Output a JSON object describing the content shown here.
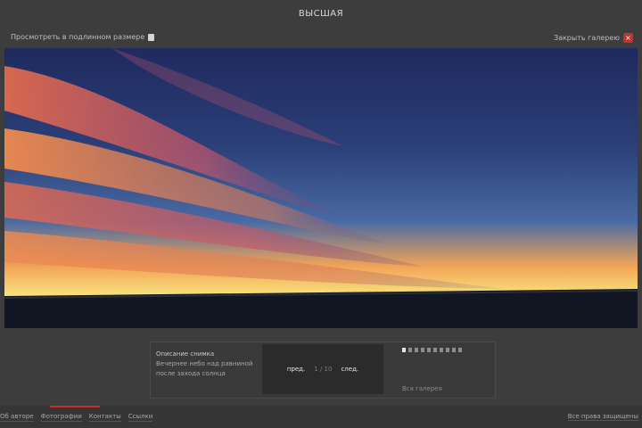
{
  "header": {
    "title": "ВЫСШАЯ"
  },
  "subbar": {
    "left_text": "Просмотреть в подлинном размере",
    "right_text": "Закрыть галерею",
    "close_glyph": "×"
  },
  "photo": {
    "alt": "Закат"
  },
  "caption": {
    "title": "Описание снимка",
    "text": "Вечернее небо над равниной после захода солнца"
  },
  "nav": {
    "prev_label": "пред.",
    "counter": "1 / 10",
    "next_label": "след."
  },
  "thumbs": {
    "count": 10,
    "active_index": 0
  },
  "gallery_link": "Вся галерея",
  "footer": {
    "links": [
      "Об авторе",
      "Фотографии",
      "Контакты",
      "Ссылки"
    ],
    "right_link": "Все права защищены"
  }
}
